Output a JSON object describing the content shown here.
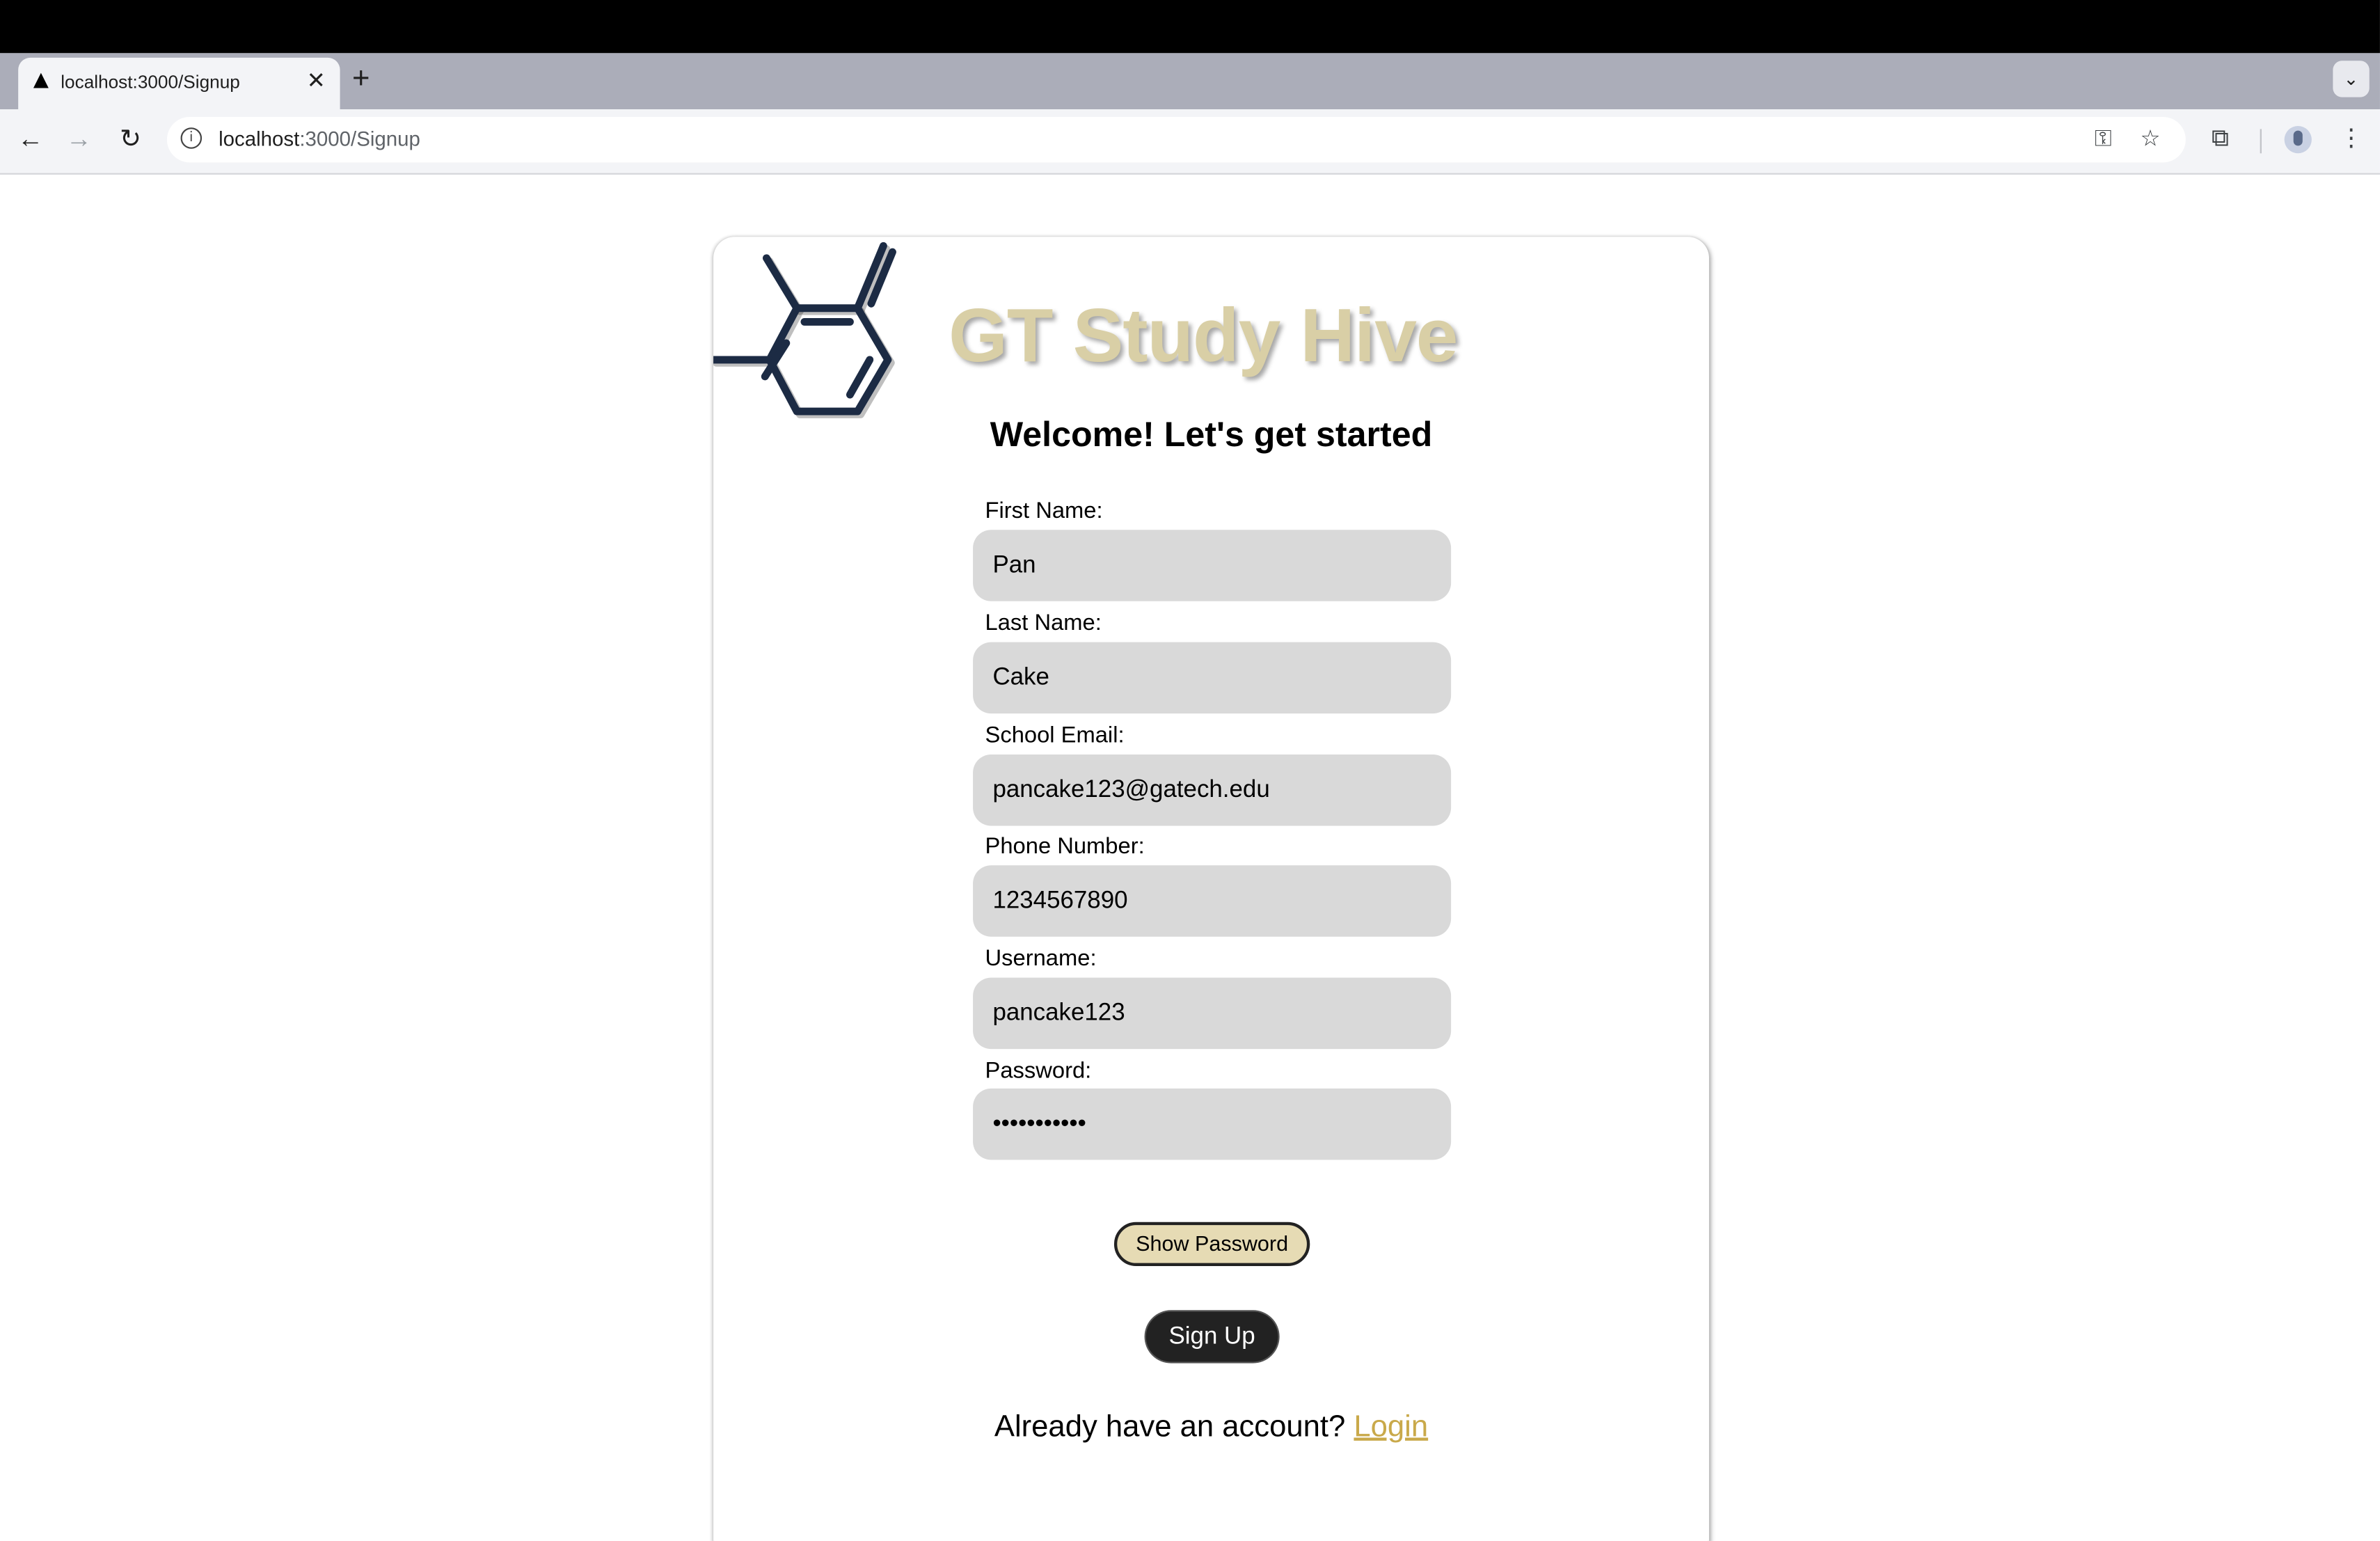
{
  "browser": {
    "tab_title": "localhost:3000/Signup",
    "tab_close": "✕",
    "new_tab": "+",
    "tab_search": "⌄",
    "url_host": "localhost",
    "url_path": ":3000/Signup",
    "back": "←",
    "forward": "→",
    "reload": "↻",
    "key_icon": "⚿",
    "star_icon": "☆",
    "extensions_icon": "⧉",
    "menu_icon": "⋮"
  },
  "app": {
    "brand": "GT Study Hive",
    "welcome": "Welcome! Let's get started",
    "fields": {
      "first_name": {
        "label": "First Name:",
        "value": "Pan"
      },
      "last_name": {
        "label": "Last Name:",
        "value": "Cake"
      },
      "email": {
        "label": "School Email:",
        "value": "pancake123@gatech.edu"
      },
      "phone": {
        "label": "Phone Number:",
        "value": "1234567890"
      },
      "username": {
        "label": "Username:",
        "value": "pancake123"
      },
      "password": {
        "label": "Password:",
        "value": "•••••••••••"
      }
    },
    "show_password": "Show Password",
    "sign_up": "Sign Up",
    "already_text": "Already have an account? ",
    "login_link": "Login"
  },
  "colors": {
    "brand": "#d9cfa6",
    "logo_stroke": "#1c2b44",
    "input_bg": "#d9d9d9",
    "show_password_bg": "#e6dbb4",
    "sign_up_bg": "#222222",
    "login_link": "#c9a94a"
  }
}
